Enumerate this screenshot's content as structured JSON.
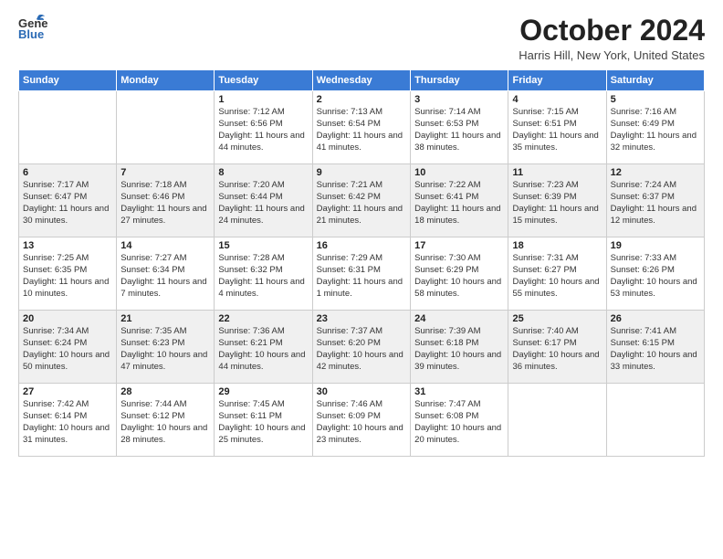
{
  "logo": {
    "general": "General",
    "blue": "Blue"
  },
  "title": "October 2024",
  "location": "Harris Hill, New York, United States",
  "days_of_week": [
    "Sunday",
    "Monday",
    "Tuesday",
    "Wednesday",
    "Thursday",
    "Friday",
    "Saturday"
  ],
  "weeks": [
    [
      {
        "day": "",
        "detail": ""
      },
      {
        "day": "",
        "detail": ""
      },
      {
        "day": "1",
        "detail": "Sunrise: 7:12 AM\nSunset: 6:56 PM\nDaylight: 11 hours and 44 minutes."
      },
      {
        "day": "2",
        "detail": "Sunrise: 7:13 AM\nSunset: 6:54 PM\nDaylight: 11 hours and 41 minutes."
      },
      {
        "day": "3",
        "detail": "Sunrise: 7:14 AM\nSunset: 6:53 PM\nDaylight: 11 hours and 38 minutes."
      },
      {
        "day": "4",
        "detail": "Sunrise: 7:15 AM\nSunset: 6:51 PM\nDaylight: 11 hours and 35 minutes."
      },
      {
        "day": "5",
        "detail": "Sunrise: 7:16 AM\nSunset: 6:49 PM\nDaylight: 11 hours and 32 minutes."
      }
    ],
    [
      {
        "day": "6",
        "detail": "Sunrise: 7:17 AM\nSunset: 6:47 PM\nDaylight: 11 hours and 30 minutes."
      },
      {
        "day": "7",
        "detail": "Sunrise: 7:18 AM\nSunset: 6:46 PM\nDaylight: 11 hours and 27 minutes."
      },
      {
        "day": "8",
        "detail": "Sunrise: 7:20 AM\nSunset: 6:44 PM\nDaylight: 11 hours and 24 minutes."
      },
      {
        "day": "9",
        "detail": "Sunrise: 7:21 AM\nSunset: 6:42 PM\nDaylight: 11 hours and 21 minutes."
      },
      {
        "day": "10",
        "detail": "Sunrise: 7:22 AM\nSunset: 6:41 PM\nDaylight: 11 hours and 18 minutes."
      },
      {
        "day": "11",
        "detail": "Sunrise: 7:23 AM\nSunset: 6:39 PM\nDaylight: 11 hours and 15 minutes."
      },
      {
        "day": "12",
        "detail": "Sunrise: 7:24 AM\nSunset: 6:37 PM\nDaylight: 11 hours and 12 minutes."
      }
    ],
    [
      {
        "day": "13",
        "detail": "Sunrise: 7:25 AM\nSunset: 6:35 PM\nDaylight: 11 hours and 10 minutes."
      },
      {
        "day": "14",
        "detail": "Sunrise: 7:27 AM\nSunset: 6:34 PM\nDaylight: 11 hours and 7 minutes."
      },
      {
        "day": "15",
        "detail": "Sunrise: 7:28 AM\nSunset: 6:32 PM\nDaylight: 11 hours and 4 minutes."
      },
      {
        "day": "16",
        "detail": "Sunrise: 7:29 AM\nSunset: 6:31 PM\nDaylight: 11 hours and 1 minute."
      },
      {
        "day": "17",
        "detail": "Sunrise: 7:30 AM\nSunset: 6:29 PM\nDaylight: 10 hours and 58 minutes."
      },
      {
        "day": "18",
        "detail": "Sunrise: 7:31 AM\nSunset: 6:27 PM\nDaylight: 10 hours and 55 minutes."
      },
      {
        "day": "19",
        "detail": "Sunrise: 7:33 AM\nSunset: 6:26 PM\nDaylight: 10 hours and 53 minutes."
      }
    ],
    [
      {
        "day": "20",
        "detail": "Sunrise: 7:34 AM\nSunset: 6:24 PM\nDaylight: 10 hours and 50 minutes."
      },
      {
        "day": "21",
        "detail": "Sunrise: 7:35 AM\nSunset: 6:23 PM\nDaylight: 10 hours and 47 minutes."
      },
      {
        "day": "22",
        "detail": "Sunrise: 7:36 AM\nSunset: 6:21 PM\nDaylight: 10 hours and 44 minutes."
      },
      {
        "day": "23",
        "detail": "Sunrise: 7:37 AM\nSunset: 6:20 PM\nDaylight: 10 hours and 42 minutes."
      },
      {
        "day": "24",
        "detail": "Sunrise: 7:39 AM\nSunset: 6:18 PM\nDaylight: 10 hours and 39 minutes."
      },
      {
        "day": "25",
        "detail": "Sunrise: 7:40 AM\nSunset: 6:17 PM\nDaylight: 10 hours and 36 minutes."
      },
      {
        "day": "26",
        "detail": "Sunrise: 7:41 AM\nSunset: 6:15 PM\nDaylight: 10 hours and 33 minutes."
      }
    ],
    [
      {
        "day": "27",
        "detail": "Sunrise: 7:42 AM\nSunset: 6:14 PM\nDaylight: 10 hours and 31 minutes."
      },
      {
        "day": "28",
        "detail": "Sunrise: 7:44 AM\nSunset: 6:12 PM\nDaylight: 10 hours and 28 minutes."
      },
      {
        "day": "29",
        "detail": "Sunrise: 7:45 AM\nSunset: 6:11 PM\nDaylight: 10 hours and 25 minutes."
      },
      {
        "day": "30",
        "detail": "Sunrise: 7:46 AM\nSunset: 6:09 PM\nDaylight: 10 hours and 23 minutes."
      },
      {
        "day": "31",
        "detail": "Sunrise: 7:47 AM\nSunset: 6:08 PM\nDaylight: 10 hours and 20 minutes."
      },
      {
        "day": "",
        "detail": ""
      },
      {
        "day": "",
        "detail": ""
      }
    ]
  ]
}
